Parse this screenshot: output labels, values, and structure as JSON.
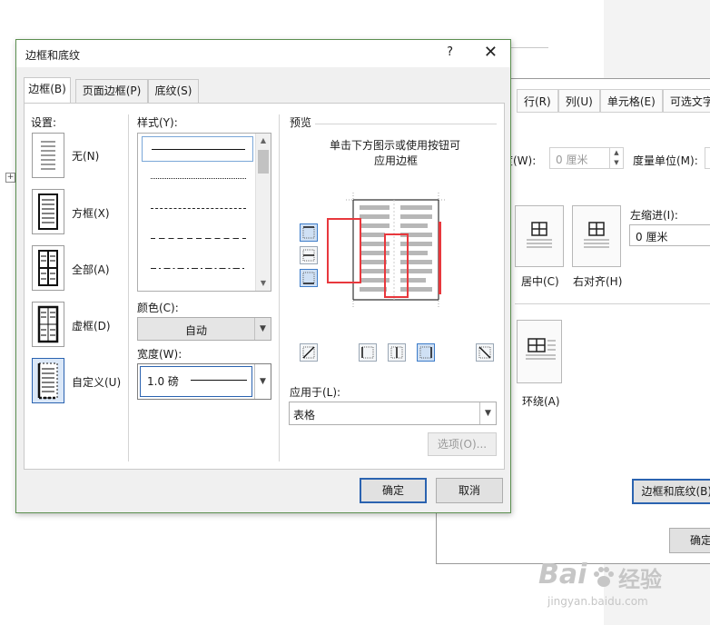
{
  "border_dialog": {
    "title": "边框和底纹",
    "help": "?",
    "close": "✕",
    "tabs": [
      {
        "label": "边框(B)",
        "active": true
      },
      {
        "label": "页面边框(P)",
        "active": false
      },
      {
        "label": "底纹(S)",
        "active": false
      }
    ],
    "settings": {
      "label": "设置:",
      "items": [
        {
          "label": "无(N)",
          "selected": false
        },
        {
          "label": "方框(X)",
          "selected": false
        },
        {
          "label": "全部(A)",
          "selected": false
        },
        {
          "label": "虚框(D)",
          "selected": false
        },
        {
          "label": "自定义(U)",
          "selected": true
        }
      ]
    },
    "style": {
      "label": "样式(Y):"
    },
    "color": {
      "label": "颜色(C):",
      "value": "自动"
    },
    "width": {
      "label": "宽度(W):",
      "value": "1.0 磅"
    },
    "preview": {
      "label": "预览",
      "hint_line1": "单击下方图示或使用按钮可",
      "hint_line2": "应用边框"
    },
    "apply_to": {
      "label": "应用于(L):",
      "value": "表格"
    },
    "options_button": "选项(O)...",
    "ok_button": "确定",
    "cancel_button": "取消",
    "highlight_color": "#e8383d",
    "accent_color": "#2b63b0"
  },
  "table_properties_dialog": {
    "tabs": [
      "行(R)",
      "列(U)",
      "单元格(E)",
      "可选文字(A)"
    ],
    "width_label": "度(W):",
    "width_value": "0 厘米",
    "unit_label": "度量单位(M):",
    "indent_label": "左缩进(I):",
    "indent_value": "0 厘米",
    "alignment": [
      {
        "label": "居中(C)"
      },
      {
        "label": "右对齐(H)"
      }
    ],
    "wrap": {
      "label": "环绕(A)"
    },
    "borders_button": "边框和底纹(B)...",
    "ok_button": "确定"
  },
  "watermark": {
    "logo": "Bai",
    "brand": "经验",
    "url": "jingyan.baidu.com"
  }
}
